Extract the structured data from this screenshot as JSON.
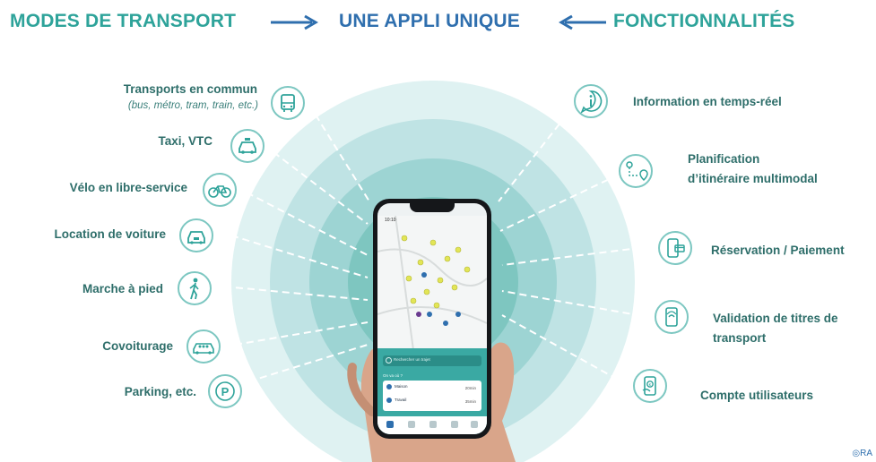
{
  "header": {
    "left": "MODES DE TRANSPORT",
    "center": "UNE APPLI UNIQUE",
    "right": "FONCTIONNALITÉS"
  },
  "modes": [
    {
      "label": "Transports en commun",
      "sub": "(bus, métro, tram, train, etc.)",
      "icon": "bus-icon"
    },
    {
      "label": "Taxi, VTC",
      "icon": "taxi-icon"
    },
    {
      "label": "Vélo en libre-service",
      "icon": "bicycle-icon"
    },
    {
      "label": "Location de voiture",
      "icon": "car-rental-icon"
    },
    {
      "label": "Marche à pied",
      "icon": "walking-icon"
    },
    {
      "label": "Covoiturage",
      "icon": "carpool-icon"
    },
    {
      "label": "Parking, etc.",
      "icon": "parking-icon"
    }
  ],
  "features": [
    {
      "label": "Information en temps-réel",
      "icon": "info-icon"
    },
    {
      "label": "Planification",
      "label2": "d’itinéraire multimodal",
      "icon": "route-planning-icon"
    },
    {
      "label": "Réservation / Paiement",
      "icon": "payment-icon"
    },
    {
      "label": "Validation de titres de",
      "label2": "transport",
      "icon": "ticket-validation-icon"
    },
    {
      "label": "Compte utilisateurs",
      "icon": "user-account-icon"
    }
  ],
  "phone": {
    "time": "10:10",
    "search_placeholder": "Rechercher un trajet",
    "where_label": "On va où ?",
    "rows": [
      {
        "label": "Maison",
        "time": "20min"
      },
      {
        "label": "Travail",
        "time": "35min"
      }
    ]
  },
  "watermark": "RA",
  "colors": {
    "teal_text": "#2ea39a",
    "blue_text": "#2f6fae",
    "ring_outer": "#d9eff0",
    "ring_mid": "#b5dfe0",
    "ring_inner": "#8fcfcf",
    "ring_core": "#6fbfb8"
  }
}
